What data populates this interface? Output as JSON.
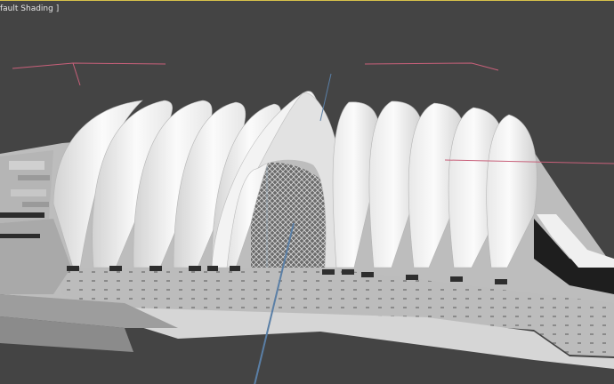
{
  "viewport": {
    "label": "fault Shading ]",
    "border_color": "#d7c24a",
    "background_color": "#444444"
  },
  "scene": {
    "shell_color": "#f4f4f4",
    "ground_color": "#bdbdbd",
    "gizmo_x_color": "#c8607a",
    "gizmo_z_color": "#5a7fa6"
  }
}
